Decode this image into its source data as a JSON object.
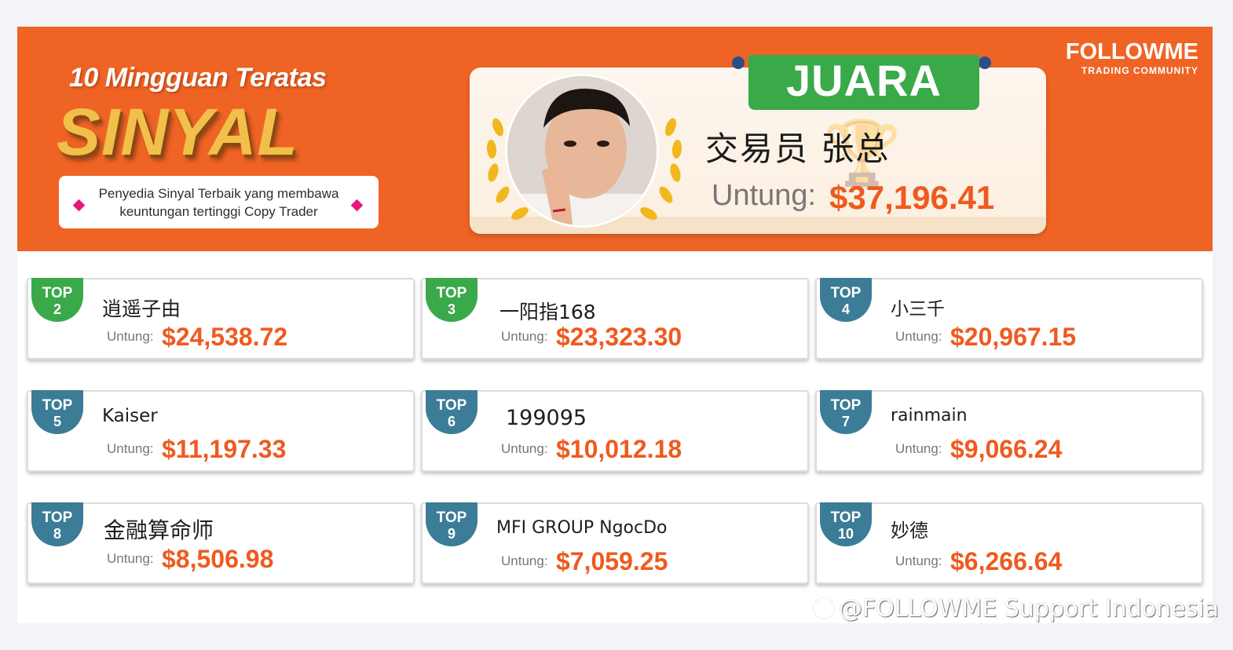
{
  "banner": {
    "title_line1": "10 Mingguan Teratas",
    "title_line2": "SINYAL",
    "subtitle_line1": "Penyedia Sinyal Terbaik yang membawa",
    "subtitle_line2": "keuntungan tertinggi Copy Trader",
    "brand_name": "FOLLOWME",
    "brand_tag": "TRADING COMMUNITY",
    "banner_color": "#ef6424"
  },
  "champion": {
    "tab_label": "JUARA",
    "name": "交易员 张总",
    "profit_label": "Untung:",
    "profit": "$37,196.41",
    "icons": [
      "laurel-icon",
      "trophy-icon"
    ]
  },
  "ranking": [
    {
      "top": "TOP",
      "rank": "2",
      "name": "逍遥子由",
      "label": "Untung:",
      "profit": "$24,538.72",
      "badge": "green"
    },
    {
      "top": "TOP",
      "rank": "3",
      "name": "一阳指168",
      "label": "Untung:",
      "profit": "$23,323.30",
      "badge": "green"
    },
    {
      "top": "TOP",
      "rank": "4",
      "name": "小三千",
      "label": "Untung:",
      "profit": "$20,967.15",
      "badge": "teal"
    },
    {
      "top": "TOP",
      "rank": "5",
      "name": "Kaiser",
      "label": "Untung:",
      "profit": "$11,197.33",
      "badge": "teal"
    },
    {
      "top": "TOP",
      "rank": "6",
      "name": "199095",
      "label": "Untung:",
      "profit": "$10,012.18",
      "badge": "teal"
    },
    {
      "top": "TOP",
      "rank": "7",
      "name": "rainmain",
      "label": "Untung:",
      "profit": "$9,066.24",
      "badge": "teal"
    },
    {
      "top": "TOP",
      "rank": "8",
      "name": "金融算命师",
      "label": "Untung:",
      "profit": "$8,506.98",
      "badge": "teal"
    },
    {
      "top": "TOP",
      "rank": "9",
      "name": "MFI GROUP NgocDo",
      "label": "Untung:",
      "profit": "$7,059.25",
      "badge": "teal"
    },
    {
      "top": "TOP",
      "rank": "10",
      "name": "妙德",
      "label": "Untung:",
      "profit": "$6,266.64",
      "badge": "teal"
    }
  ],
  "watermark": "@FOLLOWME Support Indonesia",
  "colors": {
    "accent": "#ef5a1e",
    "green": "#3aa94a",
    "teal": "#3c7c97"
  }
}
